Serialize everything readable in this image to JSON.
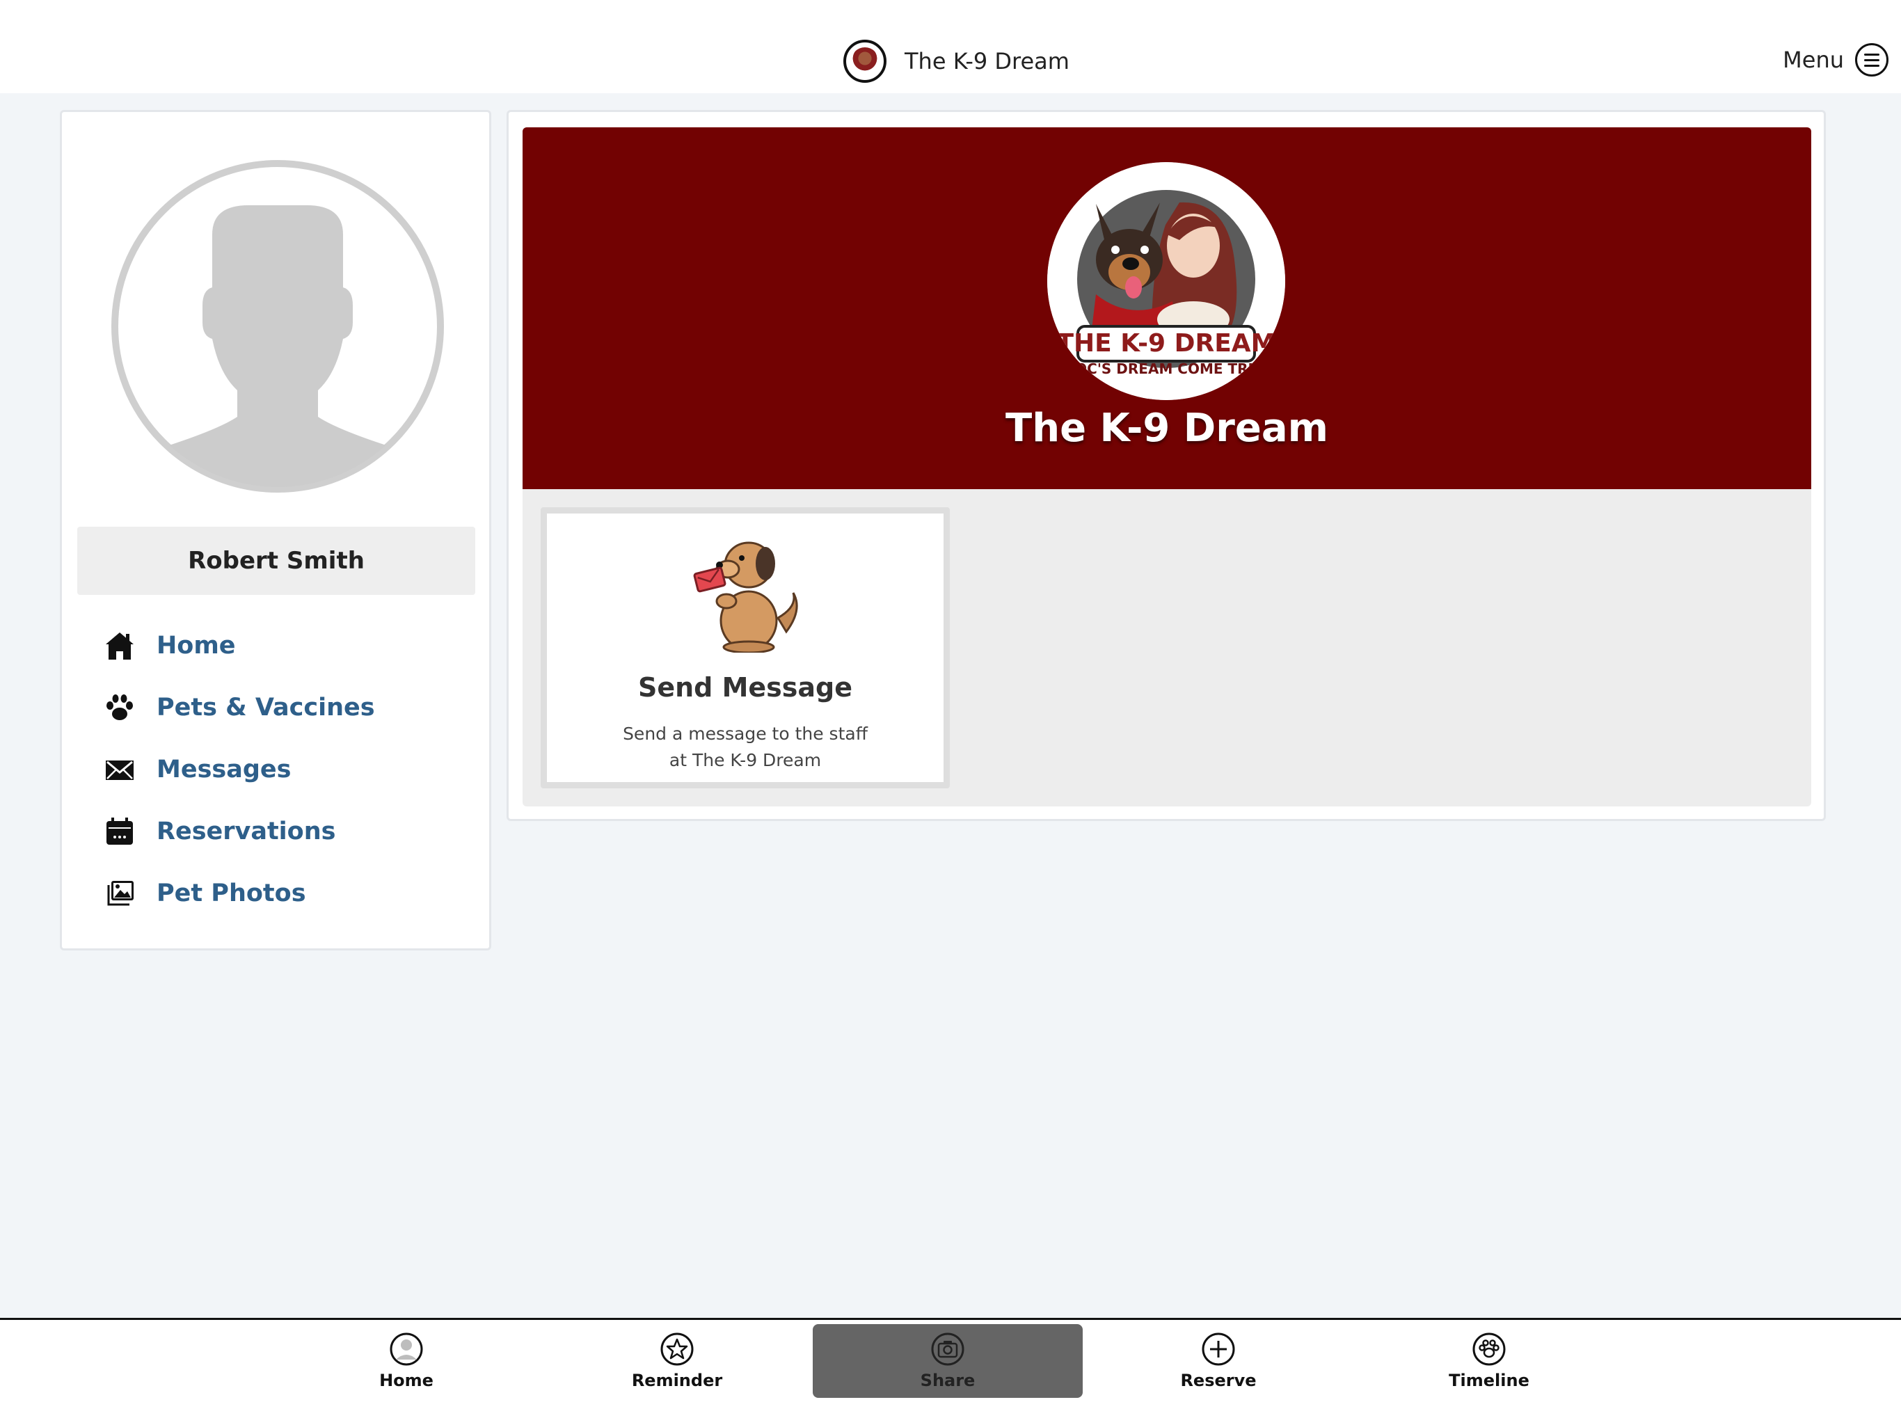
{
  "header": {
    "brand_title": "The K-9 Dream",
    "menu_label": "Menu",
    "logo_icon": "k9-dream-logo-icon",
    "menu_icon": "hamburger-circle-icon"
  },
  "profile": {
    "name": "Robert Smith",
    "avatar_icon": "default-avatar-icon"
  },
  "sidebar": {
    "items": [
      {
        "label": "Home",
        "icon": "house-icon"
      },
      {
        "label": "Pets & Vaccines",
        "icon": "paw-icon"
      },
      {
        "label": "Messages",
        "icon": "envelope-icon"
      },
      {
        "label": "Reservations",
        "icon": "calendar-icon"
      },
      {
        "label": "Pet Photos",
        "icon": "photos-icon"
      }
    ]
  },
  "hero": {
    "title": "The K-9 Dream",
    "logo_text_line1": "THE K-9 DREAM",
    "logo_text_line2": "DOC'S DREAM COME TRUE"
  },
  "card": {
    "title": "Send Message",
    "description_line1": "Send a message to the staff",
    "description_line2": "at The K-9 Dream",
    "image_icon": "dog-with-letter-icon"
  },
  "tabbar": {
    "tabs": [
      {
        "label": "Home",
        "icon": "person-circle-icon"
      },
      {
        "label": "Reminder",
        "icon": "star-circle-icon"
      },
      {
        "label": "Share",
        "icon": "camera-circle-icon"
      },
      {
        "label": "Reserve",
        "icon": "plus-circle-icon"
      },
      {
        "label": "Timeline",
        "icon": "paw-circle-icon"
      }
    ],
    "active_tab": "Share"
  },
  "colors": {
    "hero_background": "#720202",
    "nav_link": "#2e5f8a",
    "page_background": "#f2f5f8",
    "active_tab": "#656565"
  }
}
